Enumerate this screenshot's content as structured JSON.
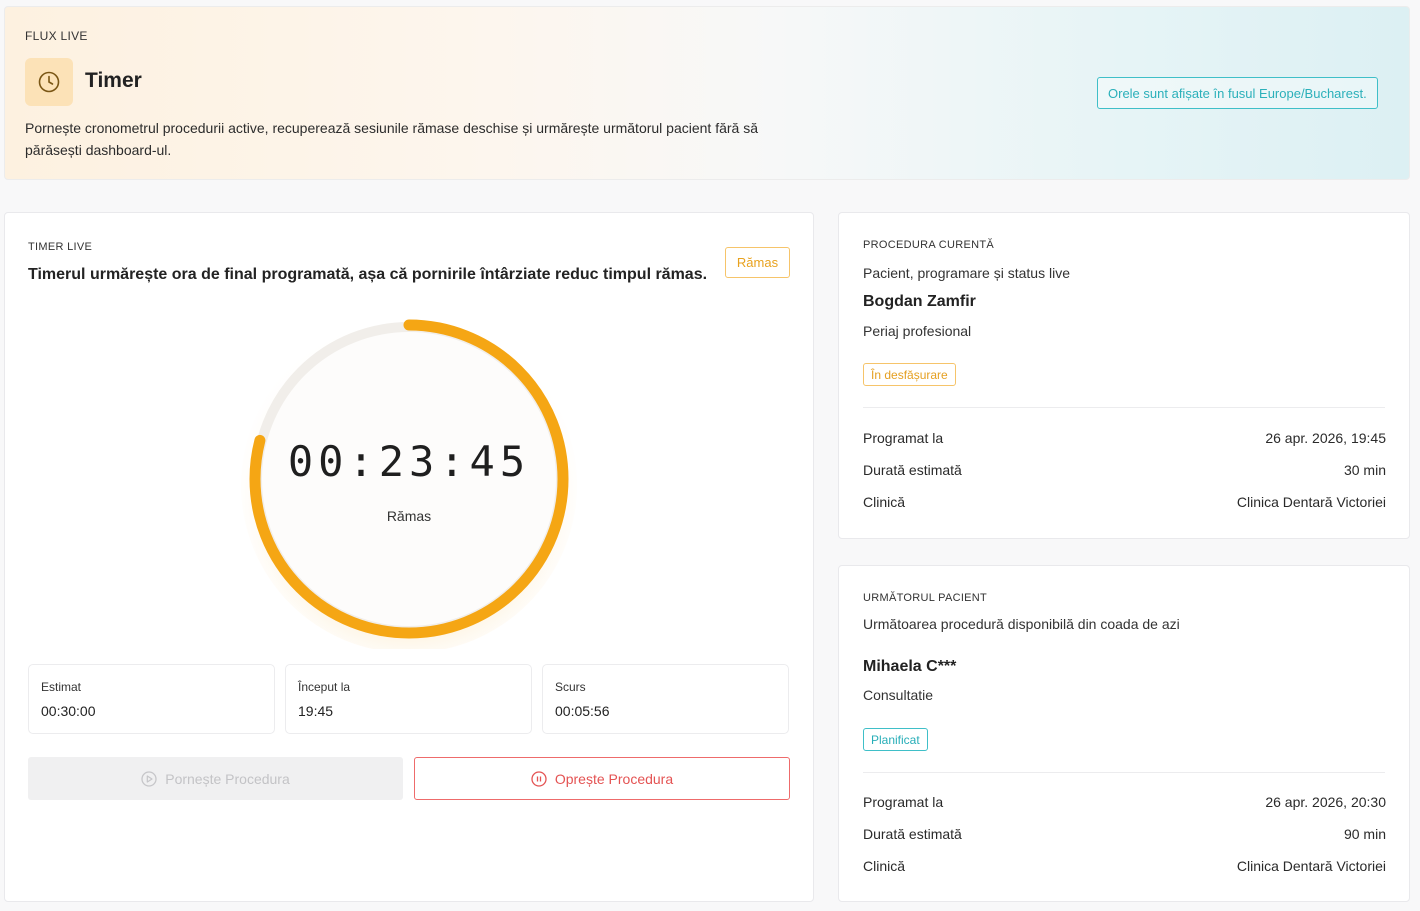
{
  "header": {
    "eyebrow": "FLUX LIVE",
    "icon": "clock-icon",
    "title": "Timer",
    "description": "Pornește cronometrul procedurii active, recuperează sesiunile rămase deschise și urmărește următorul pacient fără să părăsești dashboard-ul.",
    "timezone_note": "Orele sunt afișate în fusul Europe/Bucharest."
  },
  "timer": {
    "eyebrow": "TIMER LIVE",
    "headline": "Timerul urmărește ora de final programată, așa că pornirile întârziate reduc timpul rămas.",
    "badge": "Rămas",
    "display": "00:23:45",
    "display_label": "Rămas",
    "remaining_fraction": 0.79,
    "accent_color": "#f5a614",
    "stats": [
      {
        "label": "Estimat",
        "value": "00:30:00"
      },
      {
        "label": "Început la",
        "value": "19:45"
      },
      {
        "label": "Scurs",
        "value": "00:05:56"
      }
    ],
    "start_button": {
      "label": "Pornește Procedura",
      "icon": "play-circle-icon",
      "disabled": true
    },
    "stop_button": {
      "label": "Oprește Procedura",
      "icon": "pause-circle-icon"
    }
  },
  "current_procedure": {
    "eyebrow": "PROCEDURA CURENTĂ",
    "subtitle": "Pacient, programare și status live",
    "patient": "Bogdan Zamfir",
    "procedure": "Periaj profesional",
    "status": "În desfășurare",
    "status_color": "#e5a022",
    "rows": [
      {
        "label": "Programat la",
        "value": "26 apr. 2026, 19:45"
      },
      {
        "label": "Durată estimată",
        "value": "30 min"
      },
      {
        "label": "Clinică",
        "value": "Clinica Dentară Victoriei"
      }
    ]
  },
  "next_patient": {
    "eyebrow": "URMĂTORUL PACIENT",
    "subtitle": "Următoarea procedură disponibilă din coada de azi",
    "patient": "Mihaela C***",
    "procedure": "Consultatie",
    "status": "Planificat",
    "status_color": "#27aeb8",
    "rows": [
      {
        "label": "Programat la",
        "value": "26 apr. 2026, 20:30"
      },
      {
        "label": "Durată estimată",
        "value": "90 min"
      },
      {
        "label": "Clinică",
        "value": "Clinica Dentară Victoriei"
      }
    ]
  }
}
